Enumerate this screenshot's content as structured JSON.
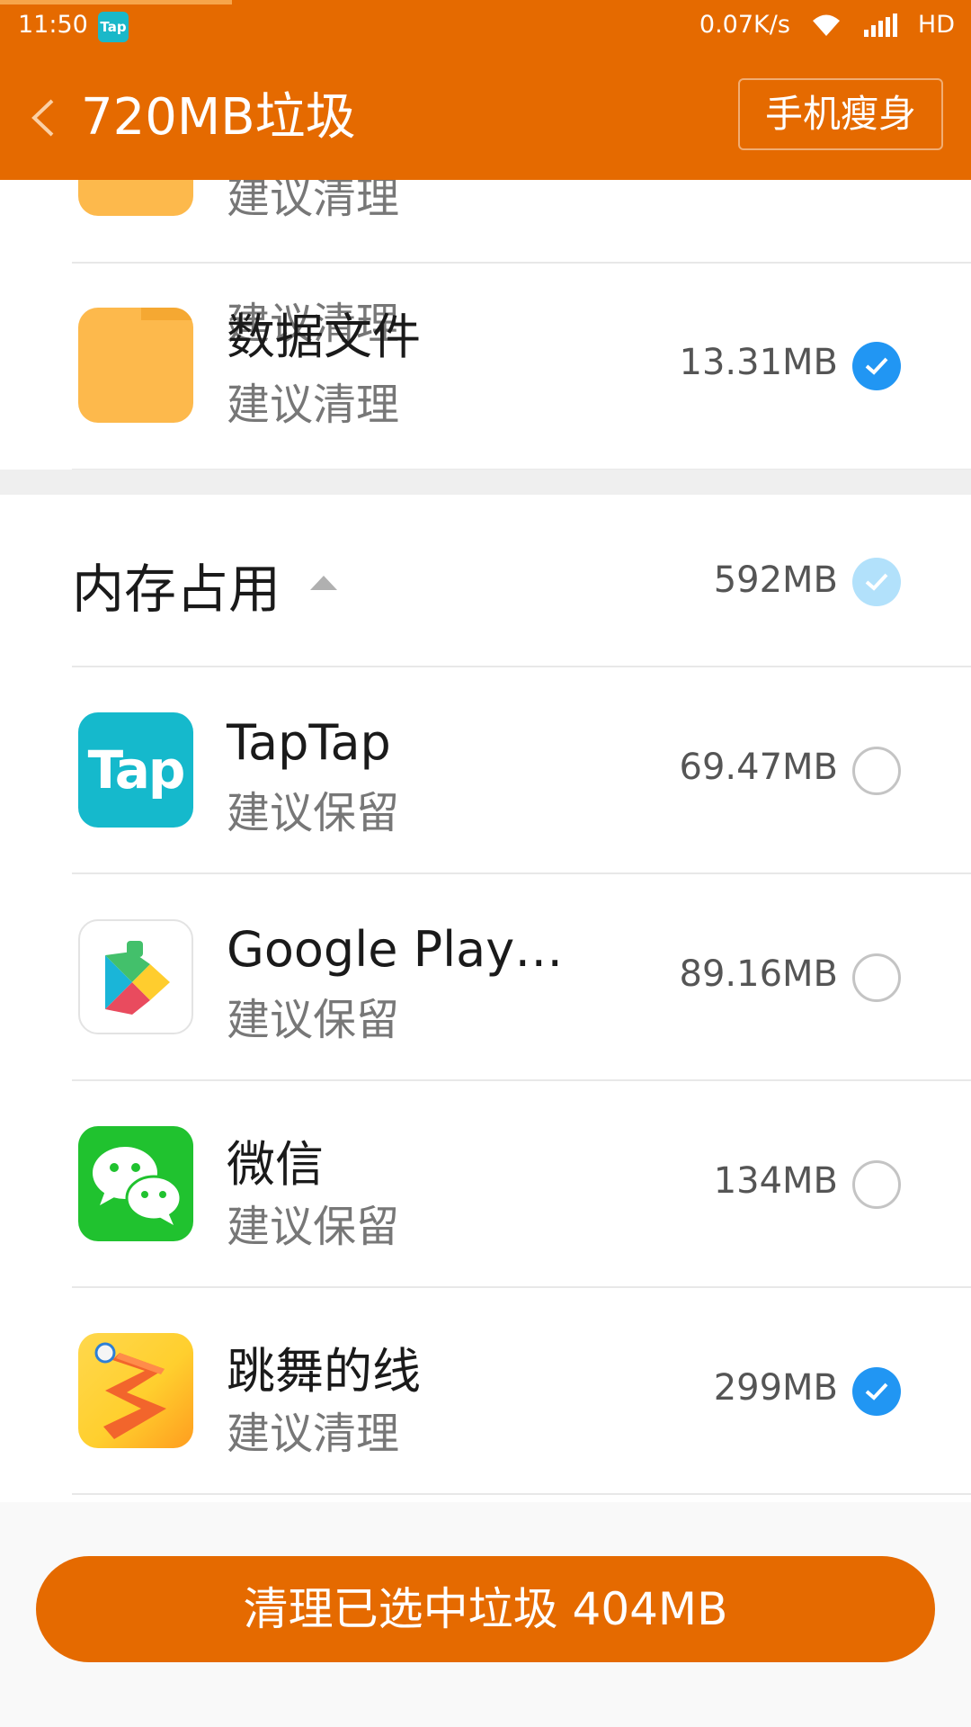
{
  "status_bar": {
    "time": "11:50",
    "app_badge": "Tap",
    "net_speed": "0.07K/s",
    "network": "HD"
  },
  "header": {
    "title": "720MB垃圾",
    "slim_button": "手机瘦身"
  },
  "junk_items": [
    {
      "name": "",
      "suggestion": "建议清理",
      "checked": true,
      "icon": "folder-icon"
    },
    {
      "name": "数据文件",
      "suggestion": "建议清理",
      "size": "13.31MB",
      "checked": true,
      "icon": "folder-icon"
    }
  ],
  "memory_section": {
    "title": "内存占用",
    "size": "592MB",
    "items": [
      {
        "name": "TapTap",
        "suggestion": "建议保留",
        "size": "69.47MB",
        "checked": false,
        "icon_text": "Tap"
      },
      {
        "name": "Google Play…",
        "suggestion": "建议保留",
        "size": "89.16MB",
        "checked": false,
        "icon": "google-play-icon"
      },
      {
        "name": "微信",
        "suggestion": "建议保留",
        "size": "134MB",
        "checked": false,
        "icon": "wechat-icon"
      },
      {
        "name": "跳舞的线",
        "suggestion": "建议清理",
        "size": "299MB",
        "checked": true,
        "icon": "dancing-line-icon"
      }
    ]
  },
  "clean_button": "清理已选中垃圾 404MB",
  "colors": {
    "accent": "#e56a00",
    "check_blue": "#2196f3"
  }
}
